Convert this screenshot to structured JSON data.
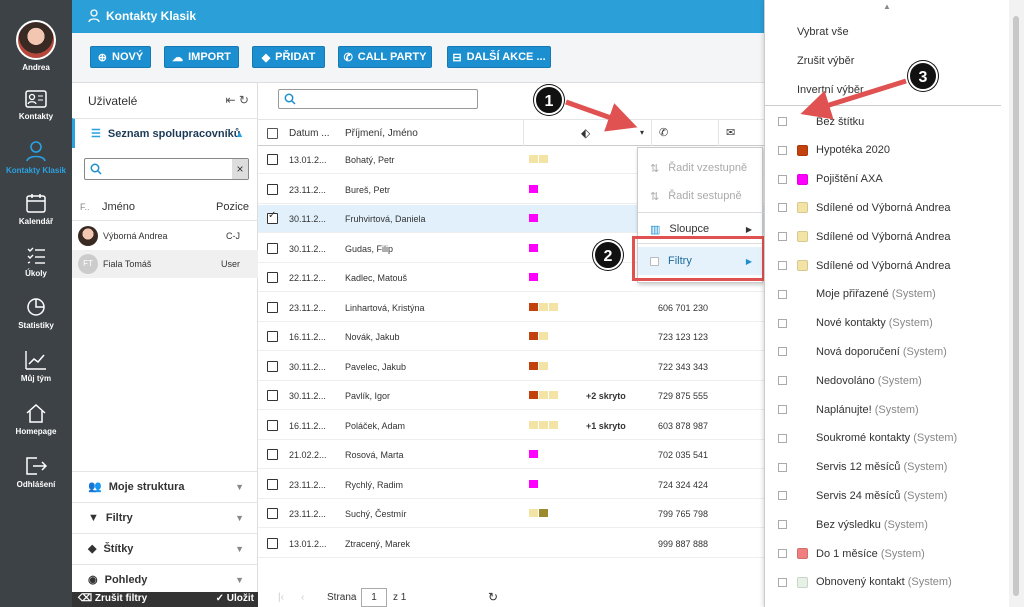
{
  "nav": {
    "user": "Andrea",
    "items": [
      {
        "label": "Kontakty"
      },
      {
        "label": "Kontakty Klasik"
      },
      {
        "label": "Kalendář"
      },
      {
        "label": "Úkoly"
      },
      {
        "label": "Statistiky"
      },
      {
        "label": "Můj tým"
      },
      {
        "label": "Homepage"
      },
      {
        "label": "Odhlášení"
      }
    ]
  },
  "header": {
    "title": "Kontakty Klasik"
  },
  "toolbar": {
    "new": "NOVÝ",
    "import": "IMPORT",
    "add": "PŘIDAT",
    "call": "CALL PARTY",
    "more": "DALŠÍ AKCE ..."
  },
  "left": {
    "title": "Uživatelé",
    "section": "Seznam spolupracovníků",
    "cols": {
      "f": "F..",
      "name": "Jméno",
      "role": "Pozice"
    },
    "users": [
      {
        "name": "Výborná Andrea",
        "role": "C-J",
        "initials": ""
      },
      {
        "name": "Fiala Tomáš",
        "role": "User",
        "initials": "FT"
      }
    ],
    "bottom": [
      {
        "label": "Moje struktura"
      },
      {
        "label": "Filtry"
      },
      {
        "label": "Štítky"
      },
      {
        "label": "Pohledy"
      }
    ],
    "footer": {
      "cancel": "Zrušit filtry",
      "save": "Uložit"
    }
  },
  "grid": {
    "cols": {
      "date": "Datum ...",
      "name": "Příjmení, Jméno"
    },
    "rows": [
      {
        "date": "13.01.2...",
        "name": "Bohatý, Petr",
        "tags": [
          "#f3e4a6",
          "#f3e4a6"
        ],
        "hidden": "",
        "phone": "",
        "sel": false
      },
      {
        "date": "23.11.2...",
        "name": "Bureš, Petr",
        "tags": [
          "#ff00ff"
        ],
        "hidden": "",
        "phone": "",
        "sel": false
      },
      {
        "date": "30.11.2...",
        "name": "Fruhvirtová, Daniela",
        "tags": [
          "#ff00ff"
        ],
        "hidden": "",
        "phone": "",
        "sel": true
      },
      {
        "date": "30.11.2...",
        "name": "Gudas, Filip",
        "tags": [
          "#ff00ff"
        ],
        "hidden": "",
        "phone": "",
        "sel": false
      },
      {
        "date": "22.11.2...",
        "name": "Kadlec, Matouš",
        "tags": [
          "#ff00ff"
        ],
        "hidden": "",
        "phone": "",
        "sel": false
      },
      {
        "date": "23.11.2...",
        "name": "Linhartová, Kristýna",
        "tags": [
          "#c2410c",
          "#f3e4a6",
          "#f3e4a6"
        ],
        "hidden": "",
        "phone": "606 701 230",
        "sel": false
      },
      {
        "date": "16.11.2...",
        "name": "Novák, Jakub",
        "tags": [
          "#c2410c",
          "#f3e4a6"
        ],
        "hidden": "",
        "phone": "723 123 123",
        "sel": false
      },
      {
        "date": "30.11.2...",
        "name": "Pavelec, Jakub",
        "tags": [
          "#c2410c",
          "#f3e4a6"
        ],
        "hidden": "",
        "phone": "722 343 343",
        "sel": false
      },
      {
        "date": "30.11.2...",
        "name": "Pavlík, Igor",
        "tags": [
          "#c2410c",
          "#f3e4a6",
          "#f3e4a6"
        ],
        "hidden": "+2 skryto",
        "phone": "729 875 555",
        "sel": false
      },
      {
        "date": "16.11.2...",
        "name": "Poláček, Adam",
        "tags": [
          "#f3e4a6",
          "#f3e4a6",
          "#f3e4a6"
        ],
        "hidden": "+1 skryto",
        "phone": "603 878 987",
        "sel": false
      },
      {
        "date": "21.02.2...",
        "name": "Rosová, Marta",
        "tags": [
          "#ff00ff"
        ],
        "hidden": "",
        "phone": "702 035 541",
        "sel": false
      },
      {
        "date": "23.11.2...",
        "name": "Rychlý, Radim",
        "tags": [
          "#ff00ff"
        ],
        "hidden": "",
        "phone": "724 324 424",
        "sel": false
      },
      {
        "date": "23.11.2...",
        "name": "Suchý, Čestmír",
        "tags": [
          "#f3e4a6",
          "#9c8a2e"
        ],
        "hidden": "",
        "phone": "799 765 798",
        "sel": false
      },
      {
        "date": "13.01.2...",
        "name": "Ztracený, Marek",
        "tags": [],
        "hidden": "",
        "phone": "999 887 888",
        "sel": false
      }
    ],
    "pager": {
      "label": "Strana",
      "page": "1",
      "of": "z 1"
    }
  },
  "menu": {
    "items": [
      {
        "label": "Řadit vzestupně"
      },
      {
        "label": "Řadit sestupně"
      },
      {
        "label": "Sloupce"
      },
      {
        "label": "Filtry"
      }
    ]
  },
  "dropdown": {
    "actions": [
      {
        "label": "Vybrat vše"
      },
      {
        "label": "Zrušit výběr"
      },
      {
        "label": "Invertní výběr"
      }
    ],
    "items": [
      {
        "label": "Bez štítku",
        "sys": "",
        "color": ""
      },
      {
        "label": "Hypotéka 2020",
        "sys": "",
        "color": "#c2410c"
      },
      {
        "label": "Pojištění AXA",
        "sys": "",
        "color": "#ff00ff"
      },
      {
        "label": "Sdílené od Výborná Andrea",
        "sys": "",
        "color": "#f3e4a6"
      },
      {
        "label": "Sdílené od Výborná Andrea",
        "sys": "",
        "color": "#f3e4a6"
      },
      {
        "label": "Sdílené od Výborná Andrea",
        "sys": "",
        "color": "#f3e4a6"
      },
      {
        "label": "Moje přiřazené",
        "sys": "(System)",
        "color": ""
      },
      {
        "label": "Nové kontakty",
        "sys": "(System)",
        "color": ""
      },
      {
        "label": "Nová doporučení",
        "sys": "(System)",
        "color": ""
      },
      {
        "label": "Nedovoláno",
        "sys": "(System)",
        "color": ""
      },
      {
        "label": "Naplánujte!",
        "sys": "(System)",
        "color": ""
      },
      {
        "label": "Soukromé kontakty",
        "sys": "(System)",
        "color": ""
      },
      {
        "label": "Servis 12 měsíců",
        "sys": "(System)",
        "color": ""
      },
      {
        "label": "Servis 24 měsíců",
        "sys": "(System)",
        "color": ""
      },
      {
        "label": "Bez výsledku",
        "sys": "(System)",
        "color": ""
      },
      {
        "label": "Do 1 měsíce",
        "sys": "(System)",
        "color": "#f08080"
      },
      {
        "label": "Obnovený kontakt",
        "sys": "(System)",
        "color": "#e6f2e6"
      }
    ]
  },
  "callouts": [
    "1",
    "2",
    "3"
  ]
}
